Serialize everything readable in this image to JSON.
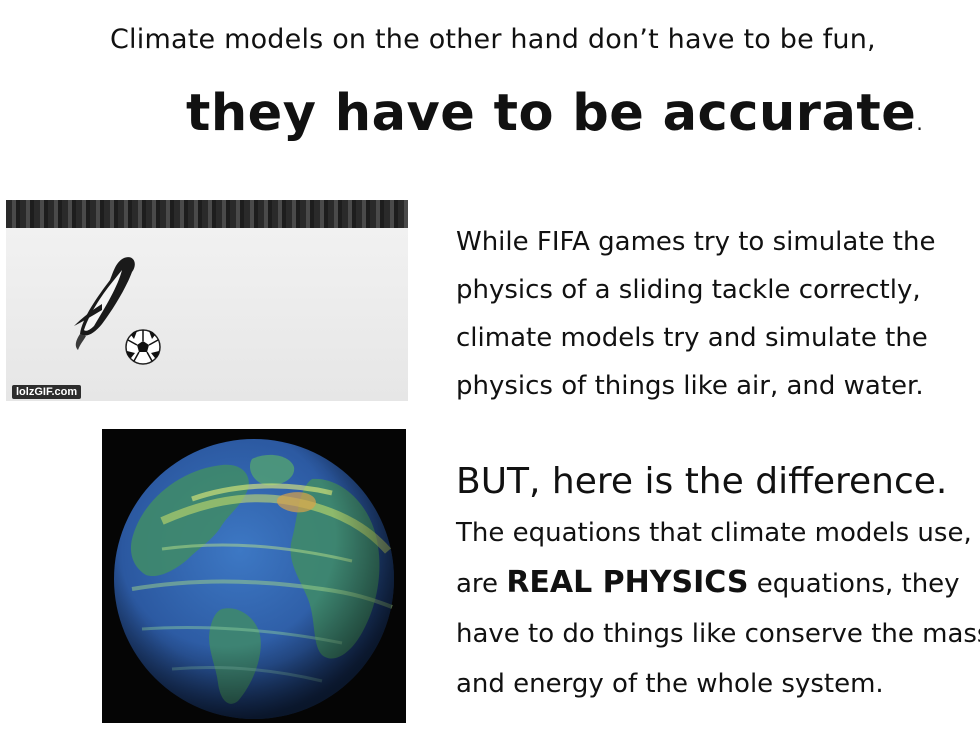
{
  "header": {
    "line1": "Climate models on the other hand don’t have to be fun,",
    "line2": "they have to be accurate",
    "line2_period": "."
  },
  "penguin_gif": {
    "watermark": "lolzGIF.com"
  },
  "paragraph1": {
    "lines": [
      "While FIFA games try to simulate the",
      "physics of a sliding tackle correctly,",
      "climate models try and simulate the",
      "physics of things like air, and water."
    ]
  },
  "paragraph2": {
    "heading": "BUT, here is the difference.",
    "line1": "The equations that climate models use,",
    "line2_pre": "are ",
    "line2_emphasis": "REAL PHYSICS",
    "line2_post": " equations, they",
    "line3": "have to do things like conserve the mass",
    "line4": "and energy of the whole system."
  },
  "colors": {
    "ocean": "#2f5fa8",
    "land": "#3f8a6a",
    "wind": "#cfe36a"
  }
}
